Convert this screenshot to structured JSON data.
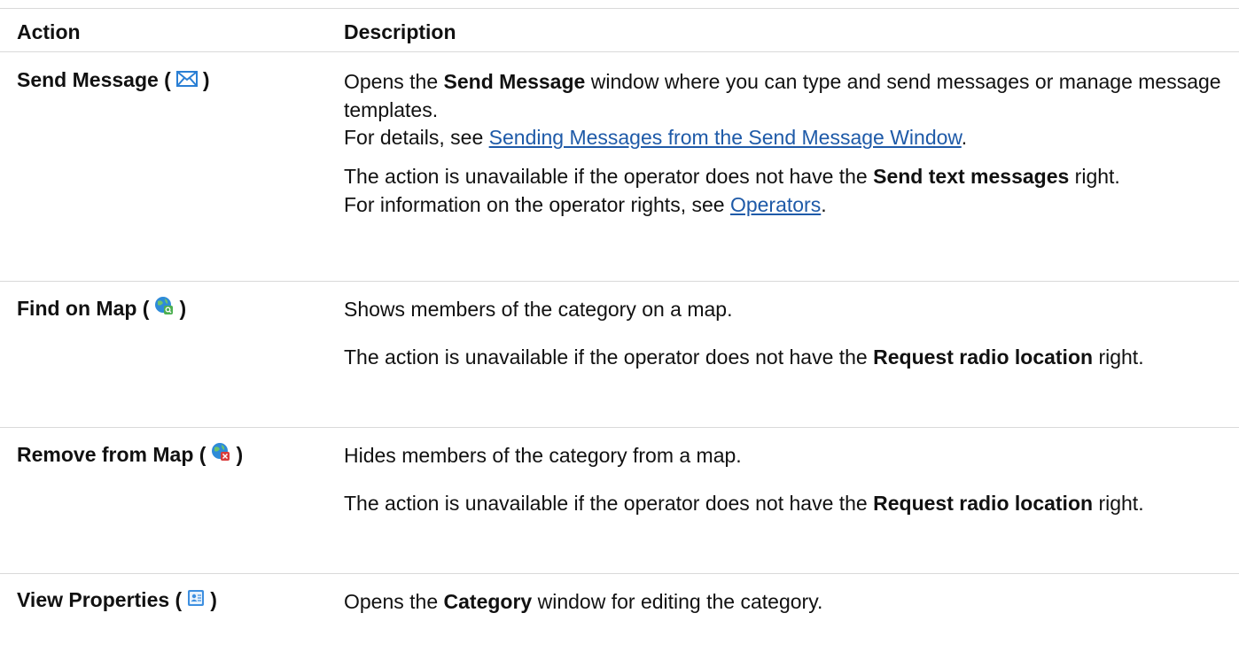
{
  "header": {
    "action": "Action",
    "description": "Description"
  },
  "rows": [
    {
      "action_label": "Send Message (",
      "action_close": ")",
      "icon": "envelope-icon",
      "p1_pre": "Opens the ",
      "p1_bold": "Send Message",
      "p1_post": " window where you can type and send messages or manage message templates.",
      "p1_line2_pre": "For details, see ",
      "p1_link": "Sending Messages from the Send Message Window",
      "p1_line2_post": ".",
      "p2_pre": "The action is unavailable if the operator does not have the ",
      "p2_bold": "Send text messages",
      "p2_post": " right.",
      "p2_line2_pre": "For information on the operator rights, see ",
      "p2_link": "Operators",
      "p2_line2_post": "."
    },
    {
      "action_label": "Find on Map (",
      "action_close": ")",
      "icon": "globe-find-icon",
      "p1": "Shows members of the category on a map.",
      "p2_pre": "The action is unavailable if the operator does not have the ",
      "p2_bold": "Request radio location",
      "p2_post": " right."
    },
    {
      "action_label": "Remove from Map (",
      "action_close": ")",
      "icon": "globe-remove-icon",
      "p1": "Hides members of the category from a map.",
      "p2_pre": "The action is unavailable if the operator does not have the ",
      "p2_bold": "Request radio location",
      "p2_post": " right."
    },
    {
      "action_label": "View Properties (",
      "action_close": ")",
      "icon": "properties-icon",
      "p1_pre": "Opens the ",
      "p1_bold": "Category",
      "p1_post": " window for editing the category."
    }
  ],
  "colors": {
    "link": "#1e5aa8",
    "border": "#d9d9d9",
    "envelope": "#2a7fd4",
    "globe": "#2e8bd8",
    "find_badge": "#4caf50",
    "remove_badge": "#d93a3a"
  }
}
